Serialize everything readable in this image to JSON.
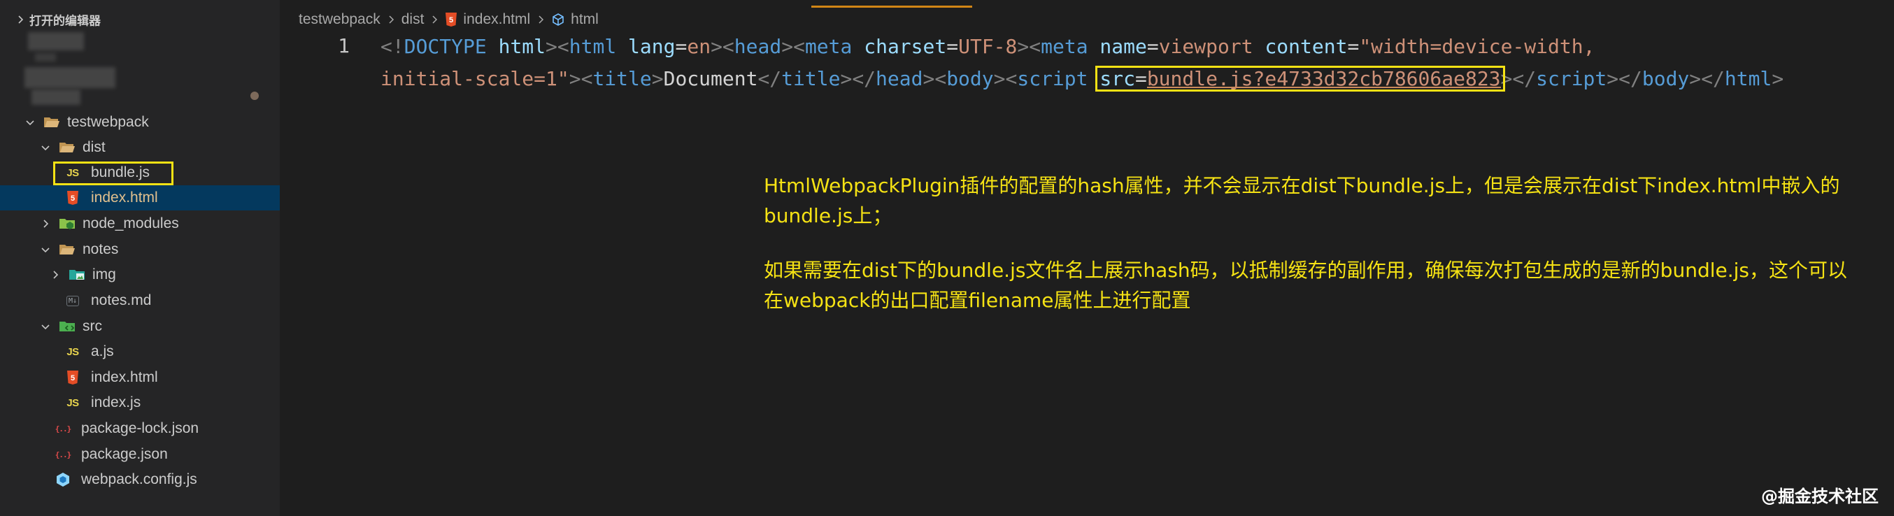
{
  "sidebar": {
    "open_editors_label": "打开的编辑器",
    "tree": [
      {
        "label": "testwebpack",
        "icon": "folder-open-icon"
      },
      {
        "label": "dist",
        "icon": "folder-open-icon"
      },
      {
        "label": "bundle.js",
        "icon": "js-file-icon",
        "badge": "JS"
      },
      {
        "label": "index.html",
        "icon": "html-file-icon",
        "badge": "5"
      },
      {
        "label": "node_modules",
        "icon": "node-folder-icon"
      },
      {
        "label": "notes",
        "icon": "folder-open-icon"
      },
      {
        "label": "img",
        "icon": "image-folder-icon"
      },
      {
        "label": "notes.md",
        "icon": "markdown-file-icon",
        "badge": "M↓"
      },
      {
        "label": "src",
        "icon": "src-folder-icon"
      },
      {
        "label": "a.js",
        "icon": "js-file-icon",
        "badge": "JS"
      },
      {
        "label": "index.html",
        "icon": "html-file-icon",
        "badge": "5"
      },
      {
        "label": "index.js",
        "icon": "js-file-icon",
        "badge": "JS"
      },
      {
        "label": "package-lock.json",
        "icon": "json-file-icon",
        "badge": "{..}"
      },
      {
        "label": "package.json",
        "icon": "json-file-icon",
        "badge": "{..}"
      },
      {
        "label": "webpack.config.js",
        "icon": "webpack-config-icon"
      }
    ]
  },
  "breadcrumb": {
    "items": [
      "testwebpack",
      "dist",
      "index.html",
      "html"
    ]
  },
  "editor": {
    "line_number": "1",
    "line1_tokens": [
      {
        "t": "<!",
        "c": "tk-punct"
      },
      {
        "t": "DOCTYPE",
        "c": "tk-tag"
      },
      {
        "t": " ",
        "c": "tk-text"
      },
      {
        "t": "html",
        "c": "tk-attr"
      },
      {
        "t": "><",
        "c": "tk-punct"
      },
      {
        "t": "html",
        "c": "tk-tag"
      },
      {
        "t": " ",
        "c": "tk-text"
      },
      {
        "t": "lang",
        "c": "tk-attr"
      },
      {
        "t": "=",
        "c": "tk-text"
      },
      {
        "t": "en",
        "c": "tk-str"
      },
      {
        "t": "><",
        "c": "tk-punct"
      },
      {
        "t": "head",
        "c": "tk-tag"
      },
      {
        "t": "><",
        "c": "tk-punct"
      },
      {
        "t": "meta",
        "c": "tk-tag"
      },
      {
        "t": " ",
        "c": "tk-text"
      },
      {
        "t": "charset",
        "c": "tk-attr"
      },
      {
        "t": "=",
        "c": "tk-text"
      },
      {
        "t": "UTF-8",
        "c": "tk-str"
      },
      {
        "t": "><",
        "c": "tk-punct"
      },
      {
        "t": "meta",
        "c": "tk-tag"
      },
      {
        "t": " ",
        "c": "tk-text"
      },
      {
        "t": "name",
        "c": "tk-attr"
      },
      {
        "t": "=",
        "c": "tk-text"
      },
      {
        "t": "viewport",
        "c": "tk-str"
      },
      {
        "t": " ",
        "c": "tk-text"
      },
      {
        "t": "content",
        "c": "tk-attr"
      },
      {
        "t": "=",
        "c": "tk-text"
      },
      {
        "t": "\"width=device-width,",
        "c": "tk-str"
      }
    ],
    "line2_tokens": [
      {
        "t": "initial-scale=1\"",
        "c": "tk-str"
      },
      {
        "t": "><",
        "c": "tk-punct"
      },
      {
        "t": "title",
        "c": "tk-tag"
      },
      {
        "t": ">",
        "c": "tk-punct"
      },
      {
        "t": "Document",
        "c": "tk-text"
      },
      {
        "t": "</",
        "c": "tk-punct"
      },
      {
        "t": "title",
        "c": "tk-tag"
      },
      {
        "t": "></",
        "c": "tk-punct"
      },
      {
        "t": "head",
        "c": "tk-tag"
      },
      {
        "t": "><",
        "c": "tk-punct"
      },
      {
        "t": "body",
        "c": "tk-tag"
      },
      {
        "t": "><",
        "c": "tk-punct"
      },
      {
        "t": "script",
        "c": "tk-tag"
      },
      {
        "t": " ",
        "c": "tk-text"
      },
      {
        "t": "src",
        "c": "tk-attr",
        "hl_start": true
      },
      {
        "t": "=",
        "c": "tk-text"
      },
      {
        "t": "bundle.js?e4733d32cb78606ae823",
        "c": "tk-str",
        "hl_end": true
      },
      {
        "t": "></",
        "c": "tk-punct"
      },
      {
        "t": "script",
        "c": "tk-tag"
      },
      {
        "t": "></",
        "c": "tk-punct"
      },
      {
        "t": "body",
        "c": "tk-tag"
      },
      {
        "t": "><",
        "c": "tk-punct"
      },
      {
        "t": "/",
        "c": "tk-punct"
      },
      {
        "t": "html",
        "c": "tk-tag"
      },
      {
        "t": ">",
        "c": "tk-punct"
      }
    ]
  },
  "annotation": {
    "para1": "HtmlWebpackPlugin插件的配置的hash属性，并不会显示在dist下bundle.js上，但是会展示在dist下index.html中嵌入的bundle.js上；",
    "para2": "如果需要在dist下的bundle.js文件名上展示hash码，以抵制缓存的副作用，确保每次打包生成的是新的bundle.js，这个可以在webpack的出口配置filename属性上进行配置"
  },
  "watermark": "@掘金技术社区",
  "colors": {
    "highlight": "#f5e214",
    "selection": "#04395e",
    "accent_tab": "#d18616"
  }
}
